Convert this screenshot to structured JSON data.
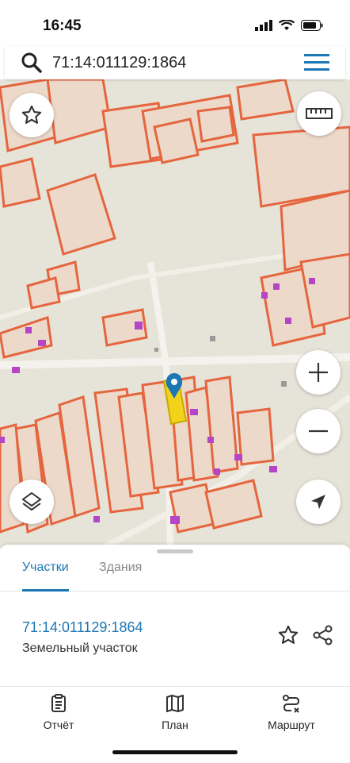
{
  "status_bar": {
    "time": "16:45"
  },
  "search": {
    "query": "71:14:011129:1864"
  },
  "map": {
    "controls": [
      "favorite-star-icon",
      "ruler-icon",
      "zoom-in-icon",
      "zoom-out-icon",
      "layers-icon",
      "location-arrow-icon"
    ]
  },
  "sheet": {
    "tabs": [
      {
        "label": "Участки",
        "active": true
      },
      {
        "label": "Здания",
        "active": false
      }
    ],
    "parcel": {
      "id": "71:14:011129:1864",
      "type": "Земельный участок"
    }
  },
  "bottom_nav": {
    "items": [
      {
        "label": "Отчёт",
        "icon": "report-icon"
      },
      {
        "label": "План",
        "icon": "map-icon"
      },
      {
        "label": "Маршрут",
        "icon": "route-icon"
      }
    ]
  },
  "colors": {
    "accent": "#1d77b5",
    "parcel_outline": "#e5653e",
    "selected_parcel": "#f2d21b"
  }
}
